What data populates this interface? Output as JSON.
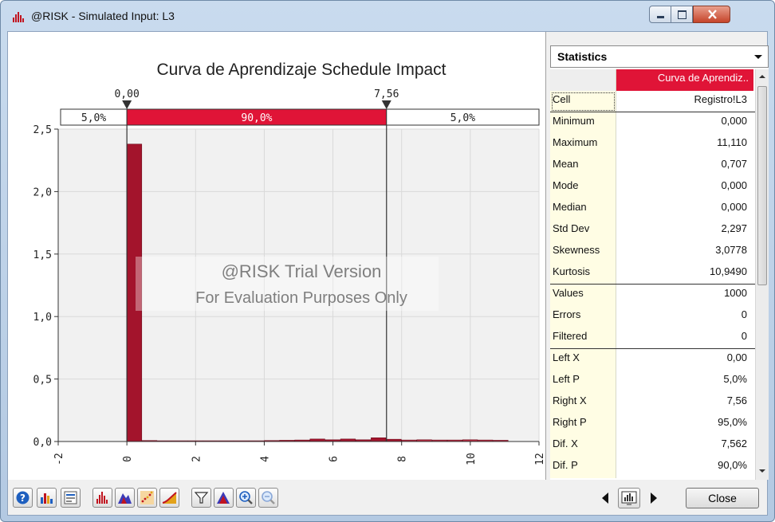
{
  "window": {
    "title": "@RISK - Simulated Input: L3"
  },
  "chart": {
    "title": "Curva de Aprendizaje Schedule Impact",
    "delimiters": {
      "left_value": "0,00",
      "right_value": "7,56"
    },
    "band": {
      "left_pct": "5,0%",
      "middle_pct": "90,0%",
      "right_pct": "5,0%"
    },
    "watermark": {
      "line1": "@RISK Trial Version",
      "line2": "For Evaluation Purposes Only"
    },
    "colors": {
      "bar": "#a3142c",
      "band": "#e01437",
      "plot_bg": "#f1f1f1"
    }
  },
  "chart_data": {
    "type": "bar",
    "title": "Curva de Aprendizaje Schedule Impact",
    "xlabel": "",
    "ylabel": "",
    "xlim": [
      -2,
      12
    ],
    "ylim": [
      0,
      2.5
    ],
    "x_ticks": [
      "-2",
      "0",
      "2",
      "4",
      "6",
      "8",
      "10",
      "12"
    ],
    "y_ticks": [
      "0,0",
      "0,5",
      "1,0",
      "1,5",
      "2,0",
      "2,5"
    ],
    "bin_width": 0.444,
    "bins": [
      {
        "x": 0.0,
        "y": 2.38
      },
      {
        "x": 0.444,
        "y": 0.008
      },
      {
        "x": 0.889,
        "y": 0.006
      },
      {
        "x": 1.333,
        "y": 0.006
      },
      {
        "x": 1.778,
        "y": 0.006
      },
      {
        "x": 2.222,
        "y": 0.006
      },
      {
        "x": 2.667,
        "y": 0.006
      },
      {
        "x": 3.111,
        "y": 0.006
      },
      {
        "x": 3.556,
        "y": 0.006
      },
      {
        "x": 4.0,
        "y": 0.008
      },
      {
        "x": 4.444,
        "y": 0.01
      },
      {
        "x": 4.889,
        "y": 0.012
      },
      {
        "x": 5.333,
        "y": 0.02
      },
      {
        "x": 5.778,
        "y": 0.014
      },
      {
        "x": 6.222,
        "y": 0.02
      },
      {
        "x": 6.667,
        "y": 0.014
      },
      {
        "x": 7.111,
        "y": 0.03
      },
      {
        "x": 7.556,
        "y": 0.018
      },
      {
        "x": 8.0,
        "y": 0.012
      },
      {
        "x": 8.444,
        "y": 0.014
      },
      {
        "x": 8.889,
        "y": 0.012
      },
      {
        "x": 9.333,
        "y": 0.012
      },
      {
        "x": 9.778,
        "y": 0.014
      },
      {
        "x": 10.222,
        "y": 0.012
      },
      {
        "x": 10.667,
        "y": 0.01
      }
    ],
    "delimiters": [
      0.0,
      7.56
    ],
    "grid": true
  },
  "stats": {
    "header": "Statistics",
    "column": "Curva de Aprendiz..",
    "rows": [
      {
        "key": "Cell",
        "value": "Registro!L3"
      },
      {
        "key": "Minimum",
        "value": "0,000"
      },
      {
        "key": "Maximum",
        "value": "11,110"
      },
      {
        "key": "Mean",
        "value": "0,707"
      },
      {
        "key": "Mode",
        "value": "0,000"
      },
      {
        "key": "Median",
        "value": "0,000"
      },
      {
        "key": "Std Dev",
        "value": "2,297"
      },
      {
        "key": "Skewness",
        "value": "3,0778"
      },
      {
        "key": "Kurtosis",
        "value": "10,9490"
      },
      {
        "key": "Values",
        "value": "1000"
      },
      {
        "key": "Errors",
        "value": "0"
      },
      {
        "key": "Filtered",
        "value": "0"
      },
      {
        "key": "Left X",
        "value": "0,00"
      },
      {
        "key": "Left P",
        "value": "5,0%"
      },
      {
        "key": "Right X",
        "value": "7,56"
      },
      {
        "key": "Right P",
        "value": "95,0%"
      },
      {
        "key": "Dif. X",
        "value": "7,562"
      },
      {
        "key": "Dif. P",
        "value": "90,0%"
      }
    ]
  },
  "toolbar": {
    "close_label": "Close",
    "icons": [
      "help-icon",
      "summary-icon",
      "report-icon",
      "histogram-icon",
      "density-icon",
      "scatter-icon",
      "cumulative-icon",
      "filter-icon",
      "fit-icon",
      "zoom-in-icon",
      "zoom-out-icon"
    ]
  }
}
